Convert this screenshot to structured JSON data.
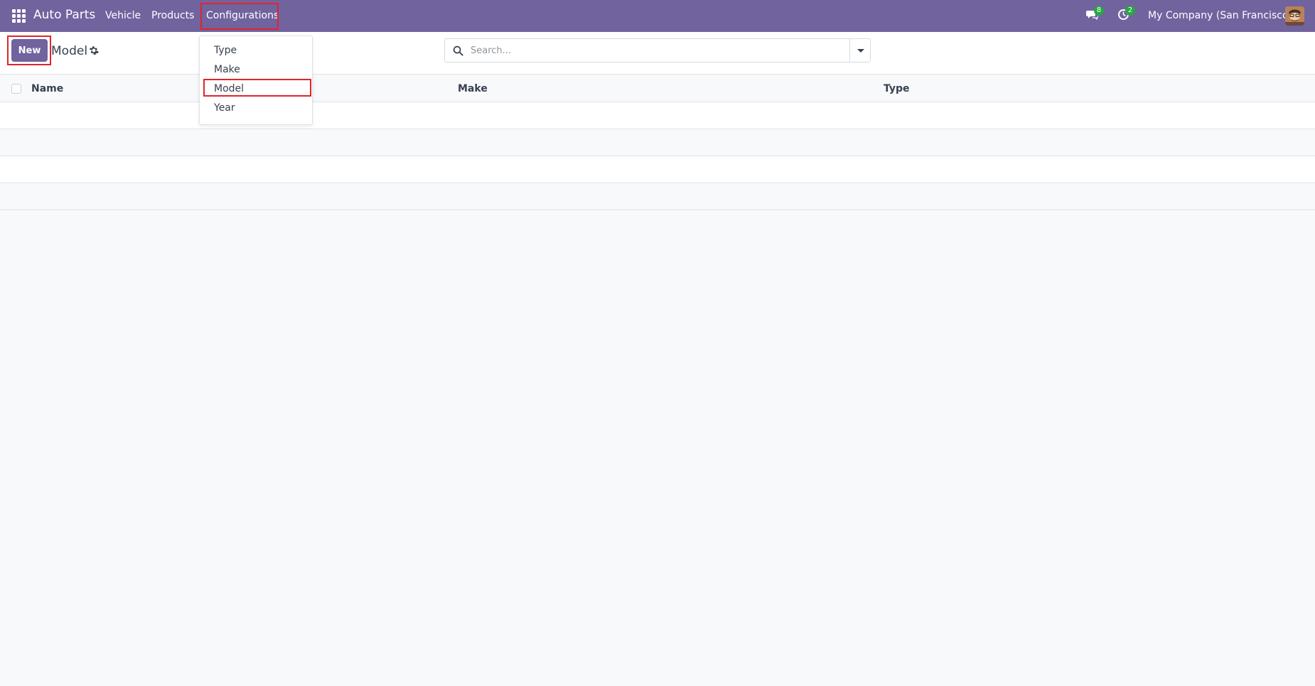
{
  "navbar": {
    "brand": "Auto Parts",
    "menu": [
      "Vehicle",
      "Products",
      "Configurations"
    ],
    "messages_count": "8",
    "activities_count": "2",
    "company": "My Company (San Francisco)"
  },
  "control_panel": {
    "new_label": "New",
    "title": "Model",
    "search_placeholder": "Search..."
  },
  "list": {
    "columns": [
      "Name",
      "Make",
      "Type"
    ]
  },
  "dropdown": {
    "items": [
      "Type",
      "Make",
      "Model",
      "Year"
    ]
  },
  "colors": {
    "brand": "#71639e",
    "highlight": "#e0242c",
    "badge": "#28a745"
  }
}
